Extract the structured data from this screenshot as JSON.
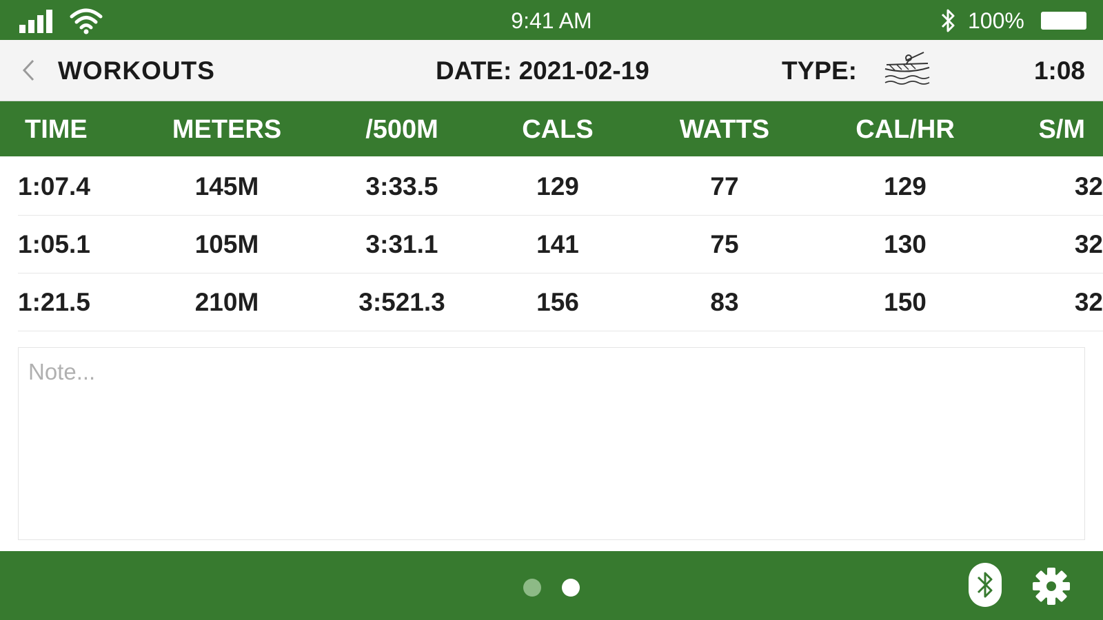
{
  "status_bar": {
    "time": "9:41 AM",
    "battery_text": "100%",
    "icons": [
      "signal-icon",
      "wifi-icon",
      "bluetooth-icon",
      "battery-icon"
    ]
  },
  "nav": {
    "back_label": "WORKOUTS",
    "date": "DATE: 2021-02-19",
    "type_label": "TYPE:",
    "type_icon": "rower-icon",
    "duration": "1:08"
  },
  "table": {
    "columns": [
      "TIME",
      "METERS",
      "/500M",
      "CALS",
      "WATTS",
      "CAL/HR",
      "S/M"
    ],
    "rows": [
      [
        "1:07.4",
        "145M",
        "3:33.5",
        "129",
        "77",
        "129",
        "32"
      ],
      [
        "1:05.1",
        "105M",
        "3:31.1",
        "141",
        "75",
        "130",
        "32"
      ],
      [
        "1:21.5",
        "210M",
        "3:521.3",
        "156",
        "83",
        "150",
        "32"
      ]
    ]
  },
  "note": {
    "placeholder": "Note...",
    "value": ""
  },
  "bottom_bar": {
    "page_count": 2,
    "current_page": 2,
    "icons": [
      "bluetooth-icon",
      "gear-icon"
    ]
  },
  "colors": {
    "brand_green": "#377a2f",
    "inactive_dot": "#8dba86",
    "nav_bg": "#f4f4f4"
  }
}
